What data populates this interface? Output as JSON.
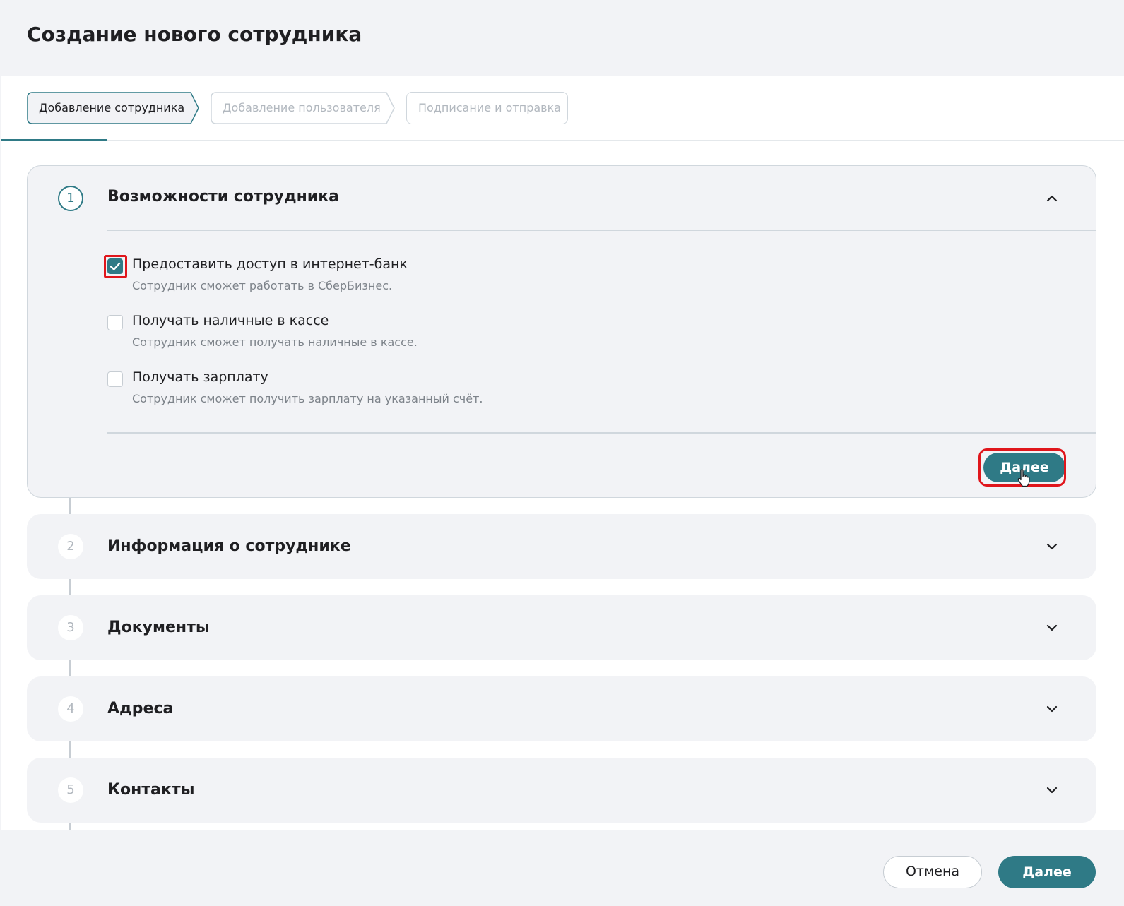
{
  "header": {
    "title": "Создание нового сотрудника"
  },
  "stepper": {
    "steps": [
      {
        "label": "Добавление сотрудника",
        "state": "active"
      },
      {
        "label": "Добавление пользователя",
        "state": "inactive"
      },
      {
        "label": "Подписание и отправка",
        "state": "inactive"
      }
    ]
  },
  "sections": [
    {
      "number": "1",
      "title": "Возможности сотрудника",
      "expanded": true,
      "options": [
        {
          "label": "Предоставить доступ в интернет-банк",
          "description": "Сотрудник сможет работать в СберБизнес.",
          "checked": true
        },
        {
          "label": "Получать наличные в кассе",
          "description": "Сотрудник сможет получать наличные в кассе.",
          "checked": false
        },
        {
          "label": "Получать зарплату",
          "description": "Сотрудник сможет получить зарплату на указанный счёт.",
          "checked": false
        }
      ],
      "next_label": "Далее"
    },
    {
      "number": "2",
      "title": "Информация о сотруднике",
      "expanded": false
    },
    {
      "number": "3",
      "title": "Документы",
      "expanded": false
    },
    {
      "number": "4",
      "title": "Адреса",
      "expanded": false
    },
    {
      "number": "5",
      "title": "Контакты",
      "expanded": false
    }
  ],
  "footer": {
    "cancel_label": "Отмена",
    "next_label": "Далее"
  },
  "colors": {
    "accent": "#2f7a86",
    "highlight": "#e0161c",
    "background": "#f2f3f6"
  },
  "icons": {
    "collapse": "chevron-up-icon",
    "expand": "chevron-down-icon",
    "check": "check-icon",
    "cursor": "hand-pointer-icon"
  }
}
